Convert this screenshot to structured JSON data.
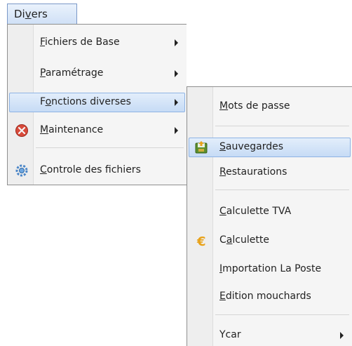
{
  "menubar": {
    "label_first": "Di",
    "label_mnemonic": "v",
    "label_rest": "ers"
  },
  "menu": {
    "items": [
      {
        "mnemonic": "F",
        "rest": "ichiers de Base",
        "submenu": true
      },
      {
        "mnemonic": "P",
        "rest": "aramétrage",
        "submenu": true
      },
      {
        "pre": "F",
        "mnemonic": "o",
        "rest": "nctions diverses",
        "submenu": true
      },
      {
        "mnemonic": "M",
        "rest": "aintenance",
        "submenu": true,
        "icon": "maintenance-tools-icon"
      },
      {
        "mnemonic": "C",
        "rest": "ontrole des fichiers",
        "icon": "settings-check-icon"
      }
    ]
  },
  "submenu": {
    "items": [
      {
        "mnemonic": "M",
        "rest": "ots de passe"
      },
      {
        "mnemonic": "S",
        "rest": "auvegardes",
        "icon": "backup-icon"
      },
      {
        "mnemonic": "R",
        "rest": "estaurations"
      },
      {
        "mnemonic": "C",
        "rest": "alculette TVA"
      },
      {
        "pre": "C",
        "mnemonic": "a",
        "rest": "lculette",
        "icon": "euro-icon"
      },
      {
        "mnemonic": "I",
        "rest": "mportation La Poste"
      },
      {
        "mnemonic": "E",
        "rest": "dition mouchards"
      },
      {
        "pre": "Ycar",
        "mnemonic": "",
        "rest": "",
        "submenu": true
      }
    ]
  },
  "colors": {
    "highlight": "#c6dbf5",
    "highlight_border": "#8eb3e4",
    "menu_bg": "#f5f5f5"
  }
}
